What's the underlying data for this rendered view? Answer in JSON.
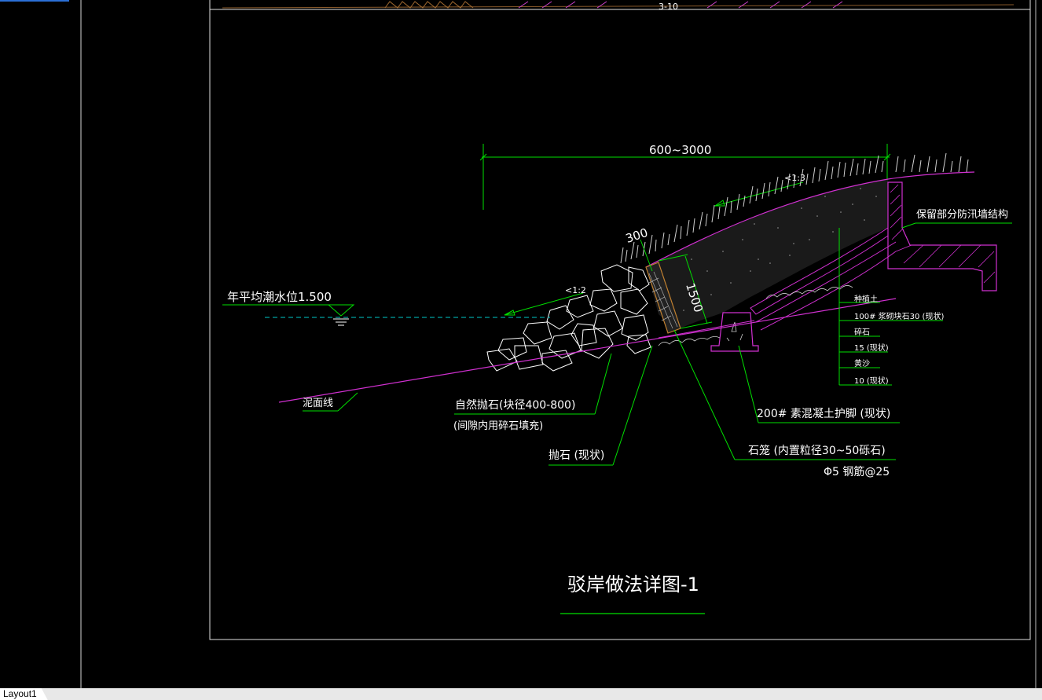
{
  "tab": {
    "layout": "Layout1"
  },
  "drawing": {
    "title": "驳岸做法详图-1",
    "dim_top": "600~3000",
    "dim_300": "300",
    "dim_1500": "1500",
    "slope_top": "<1:3",
    "slope_water": "<1:2",
    "water_level": "年平均潮水位1.500",
    "mud_line": "泥面线",
    "retain_wall": "保留部分防汛墙结构",
    "layers": [
      "种植土",
      "100# 浆砌块石30 (现状)",
      "碎石",
      "15 (现状)",
      "黄沙",
      "10 (现状)"
    ],
    "concrete_toe": "200# 素混凝土护脚 (现状)",
    "natural_stone": "自然抛石(块径400-800)",
    "natural_stone_note": "(间隙内用碎石填充)",
    "riprap": "抛石 (现状)",
    "gabion": "石笼 (内置粒径30~50砾石)",
    "rebar": "Φ5 钢筋@25",
    "top_cut_text": "3-10"
  }
}
